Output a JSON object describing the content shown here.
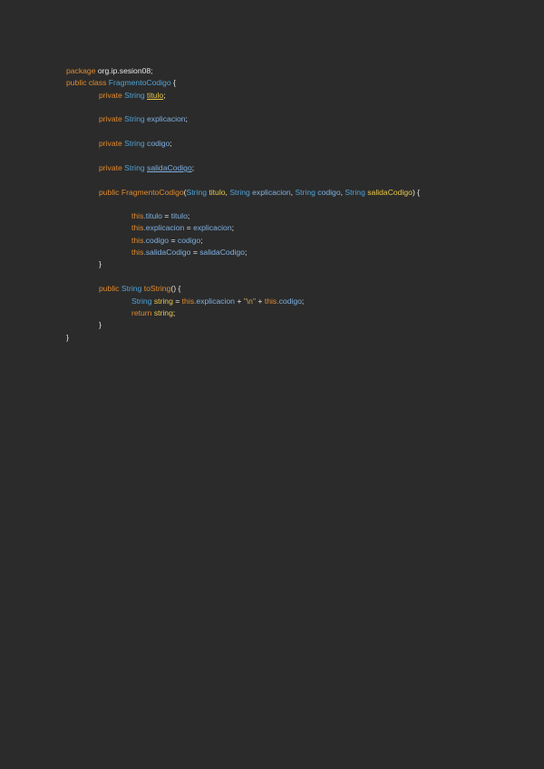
{
  "colors": {
    "background": "#2b2b2b",
    "keyword": "#e08a2e",
    "type": "#4fa3d6",
    "field": "#7fb0e0",
    "variable": "#e8c84a",
    "plain": "#e6e6e6"
  },
  "code": {
    "l1": {
      "kw": "package",
      "txt": " org.ip.sesion08;"
    },
    "l2": {
      "kw": "public class",
      "ty": " FragmentoCodigo",
      "txt": " {"
    },
    "l3": {
      "kw": "private",
      "ty": " String",
      "sp": " ",
      "fd": "titulo",
      "txt": ";"
    },
    "l4": {
      "kw": "private",
      "ty": " String",
      "sp": " ",
      "fd": "explicacion",
      "txt": ";"
    },
    "l5": {
      "kw": "private",
      "ty": " String",
      "sp": " ",
      "fd": "codigo",
      "txt": ";"
    },
    "l6": {
      "kw": "private",
      "ty": " String",
      "sp": " ",
      "fd": "salidaCodigo",
      "txt": ";"
    },
    "l7": {
      "kw": "public",
      "ty": " FragmentoCodigo",
      "p0": "(",
      "t1": "String",
      "v1": " titulo",
      "p1": ", ",
      "t2": "String",
      "v2": " explicacion",
      "p2": ", ",
      "t3": "String",
      "v3": " codigo",
      "p3": ", ",
      "t4": "String",
      "v4": " salidaCodigo",
      "p4": ") {"
    },
    "l8": {
      "kw": "this",
      "fd": ".titulo",
      "op": " = ",
      "v": "titulo",
      "txt": ";"
    },
    "l9": {
      "kw": "this",
      "fd": ".explicacion",
      "op": " = ",
      "v": "explicacion",
      "txt": ";"
    },
    "l10": {
      "kw": "this",
      "fd": ".codigo",
      "op": " = ",
      "v": "codigo",
      "txt": ";"
    },
    "l11": {
      "kw": "this",
      "fd": ".salidaCodigo",
      "op": " = ",
      "v": "salidaCodigo",
      "txt": ";"
    },
    "l12": {
      "txt": "}"
    },
    "l13": {
      "kw": "public",
      "ty": " String",
      "m": " toString",
      "txt": "() {"
    },
    "l14": {
      "ty": "String",
      "v": " string",
      "op1": " = ",
      "kw1": "this",
      "fd1": ".explicacion",
      "op2": " + ",
      "s": "\"\\n\"",
      "op3": " + ",
      "kw2": "this",
      "fd2": ".codigo",
      "txt": ";"
    },
    "l15": {
      "kw": "return",
      "v": " string",
      "txt": ";"
    },
    "l16": {
      "txt": "}"
    },
    "l17": {
      "txt": "}"
    }
  }
}
